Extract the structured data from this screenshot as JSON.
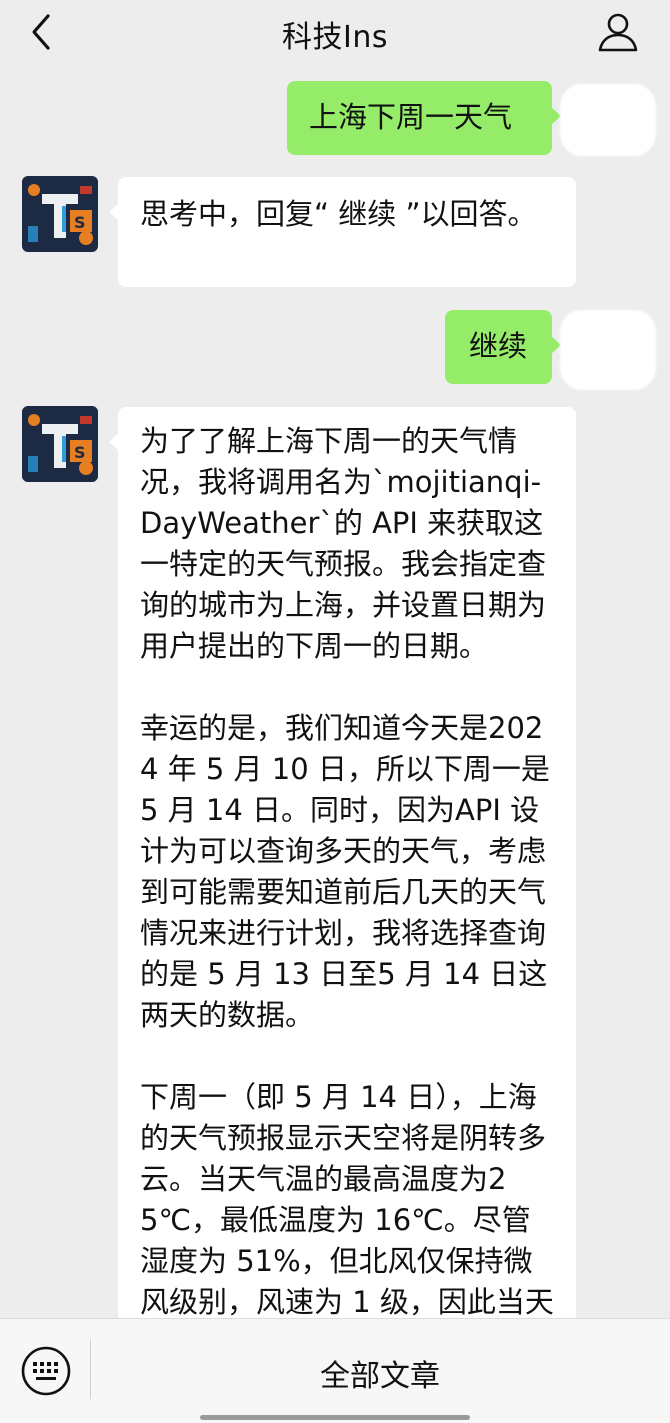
{
  "header": {
    "title": "科技Ins",
    "back_icon": "chevron-left-icon",
    "profile_icon": "person-icon"
  },
  "messages": [
    {
      "sender": "me",
      "text": "上海下周一天气"
    },
    {
      "sender": "bot",
      "text": "思考中，回复“ 继续 ”以回答。"
    },
    {
      "sender": "me",
      "text": "继续"
    },
    {
      "sender": "bot",
      "paragraphs": [
        "为了了解上海下周一的天气情况，我将调用名为`mojitianqi-DayWeather`的 API 来获取这一特定的天气预报。我会指定查询的城市为上海，并设置日期为用户提出的下周一的日期。",
        "幸运的是，我们知道今天是2024 年 5 月 10 日，所以下周一是 5 月 14 日。同时，因为API 设计为可以查询多天的天气，考虑到可能需要知道前后几天的天气情况来进行计划，我将选择查询的是 5 月 13 日至5 月 14 日这两天的数据。",
        "下周一（即 5 月 14 日），上海的天气预报显示天空将是阴转多云。当天气温的最高温度为25℃，最低温度为 16℃。尽管湿度为 51%，但北风仅保持微风级别，风速为 1 级，因此当天的天气条件相对舒适，适合"
      ]
    }
  ],
  "bottom_bar": {
    "keyboard_icon": "keyboard-icon",
    "menu_label": "全部文章"
  },
  "colors": {
    "background": "#ededed",
    "my_bubble": "#95ec69",
    "bot_bubble": "#ffffff"
  }
}
